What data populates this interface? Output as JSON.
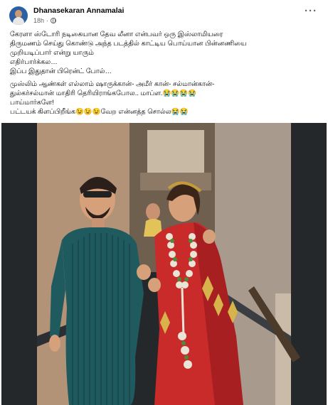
{
  "post": {
    "author": "Dhanasekaran Annamalai",
    "time": "18h",
    "separator": "·",
    "more_label": "···",
    "lines": [
      "கேரளா ஸ்டோரி நடிகையான தேவ லீனா  என்பவர் ஒரு இஸ்லாமியரை",
      "திருமணம் செய்து கொண்டு அந்த படத்தில் காட்டிய பொய்யான பின்னணியை",
      "முறியடிப்பார் என்று யாரும்",
      " எதிர்பார்க்கல…",
      "இப்ப இதுதான் பிரென்ட் போல்…"
    ],
    "lines2": [
      "முஸ்லிம் ஆண்கள் எல்லாம் ஷாருக்கான்- அமீர் கான்- சல்மான்கான்-",
      "துல்கர்சல்மான் மாதிரி தெரியிராங்கபோல.. மாப்ள.😭😭😭😭",
      "பாய்மார்களே!",
      "பட்டயக் கிளப்பிறீங்க😉😉😉வேற என்னத்த சொல்ல😭😭"
    ]
  },
  "photo": {
    "subject": "wedding-photo",
    "colors": {
      "wall": "#b89a7e",
      "kurta": "#1f5a5e",
      "saree": "#c92a2a",
      "garland": "#e9e4d6",
      "skin": "#d6a07b"
    }
  }
}
